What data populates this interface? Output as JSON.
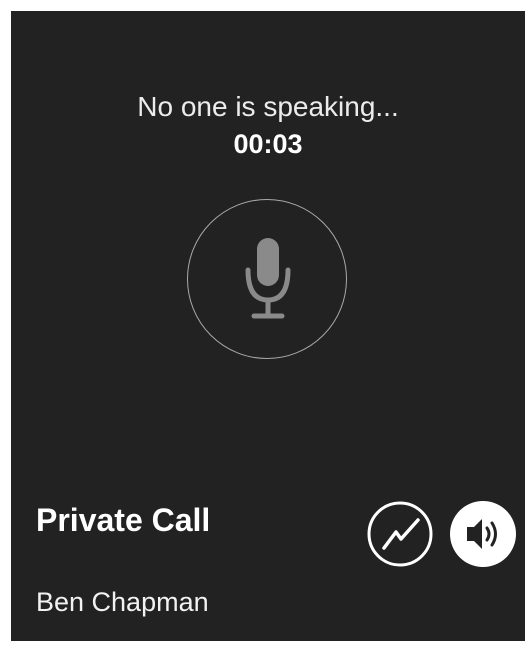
{
  "call": {
    "status": "No one is speaking...",
    "timer": "00:03",
    "title": "Private Call",
    "contact": "Ben Chapman"
  },
  "icons": {
    "mic": "microphone-icon",
    "signal": "signal-graph-icon",
    "speaker": "speaker-icon"
  },
  "colors": {
    "background": "#222222",
    "frame": "#ffffff",
    "mic_ring": "#a9a9a9",
    "mic_glyph": "#8a8a8a",
    "text": "#ffffff"
  }
}
